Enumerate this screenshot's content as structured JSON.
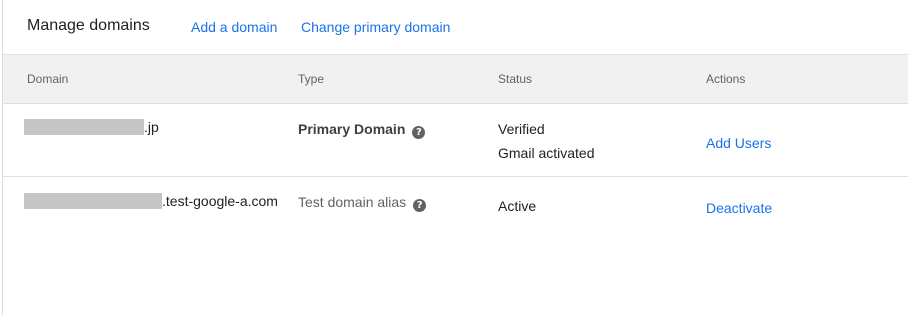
{
  "header": {
    "title": "Manage domains",
    "add_domain_link": "Add a domain",
    "change_primary_link": "Change primary domain"
  },
  "table": {
    "columns": {
      "domain": "Domain",
      "type": "Type",
      "status": "Status",
      "actions": "Actions"
    },
    "rows": [
      {
        "domain_suffix": ".jp",
        "type": "Primary Domain",
        "status_line1": "Verified",
        "status_line2": "Gmail activated",
        "action": "Add Users"
      },
      {
        "domain_suffix": ".test-google-a.com",
        "type": "Test domain alias",
        "status_line1": "Active",
        "action": "Deactivate"
      }
    ]
  },
  "icons": {
    "help": "help-circle-icon"
  },
  "colors": {
    "link": "#1a73e8",
    "header_bg": "#f1f1f1",
    "redaction": "#c6c6c6"
  }
}
